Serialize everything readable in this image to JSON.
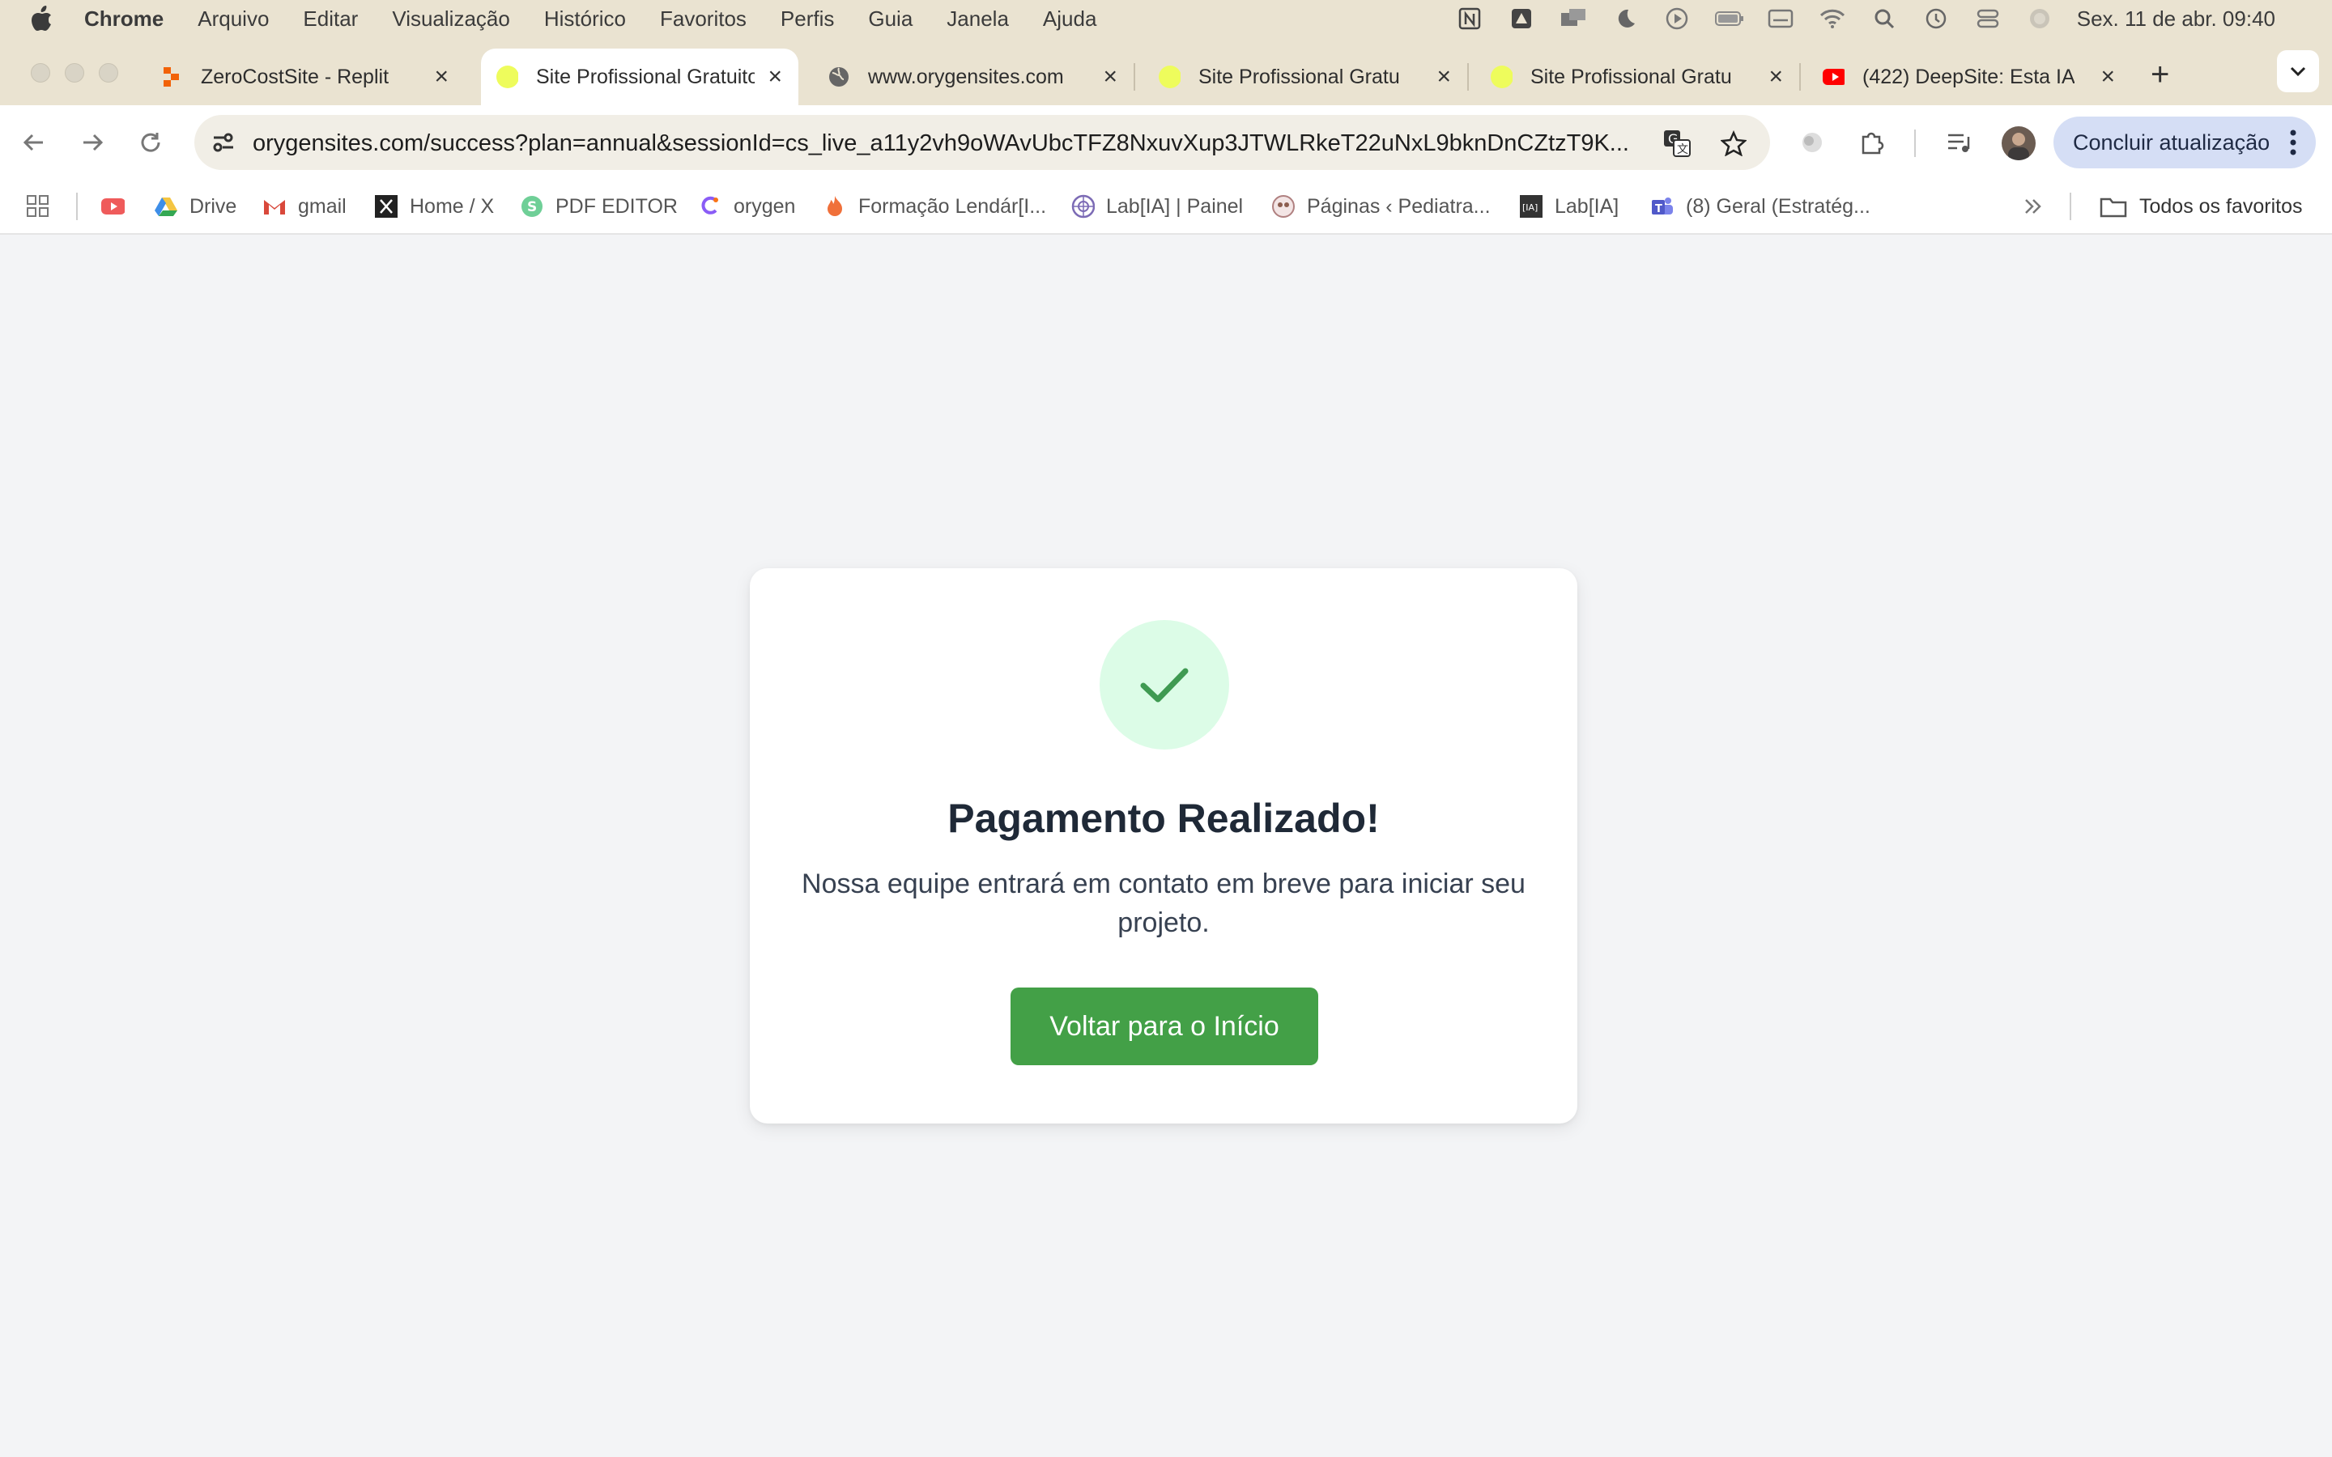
{
  "menubar": {
    "app": "Chrome",
    "items": [
      "Arquivo",
      "Editar",
      "Visualização",
      "Histórico",
      "Favoritos",
      "Perfis",
      "Guia",
      "Janela",
      "Ajuda"
    ],
    "clock": "Sex. 11 de abr.  09:40"
  },
  "tabs": [
    {
      "title": "ZeroCostSite - Replit",
      "favicon": "replit-icon"
    },
    {
      "title": "Site Profissional Gratuito",
      "favicon": "yellow-dot-icon",
      "active": true
    },
    {
      "title": "www.orygensites.com",
      "favicon": "globe-icon"
    },
    {
      "title": "Site Profissional Gratuito",
      "favicon": "yellow-dot-icon"
    },
    {
      "title": "Site Profissional Gratuito",
      "favicon": "yellow-dot-icon"
    },
    {
      "title": "(422) DeepSite: Esta IA",
      "favicon": "youtube-icon"
    }
  ],
  "toolbar": {
    "url": "orygensites.com/success?plan=annual&sessionId=cs_live_a11y2vh9oWAvUbcTFZ8NxuvXup3JTWLRkeT22uNxL9bknDnCZtzT9K...",
    "update_label": "Concluir atualização"
  },
  "bookmarks": {
    "items": [
      {
        "label": "",
        "icon": "youtube-icon"
      },
      {
        "label": "Drive",
        "icon": "drive-icon"
      },
      {
        "label": "gmail",
        "icon": "gmail-icon"
      },
      {
        "label": "Home / X",
        "icon": "x-icon"
      },
      {
        "label": "PDF EDITOR",
        "icon": "pdf-editor-icon"
      },
      {
        "label": "orygen",
        "icon": "orygen-icon"
      },
      {
        "label": "Formação Lendár[I...",
        "icon": "flame-icon"
      },
      {
        "label": "Lab[IA] | Painel",
        "icon": "lab-icon"
      },
      {
        "label": "Páginas ‹ Pediatra...",
        "icon": "pediatra-icon"
      },
      {
        "label": "Lab[IA]",
        "icon": "labia-icon"
      },
      {
        "label": "(8) Geral (Estratég...",
        "icon": "teams-icon"
      }
    ],
    "all_label": "Todos os favoritos"
  },
  "page": {
    "title": "Pagamento Realizado!",
    "message": "Nossa equipe entrará em contato em breve para iniciar seu projeto.",
    "button": "Voltar para o Início"
  },
  "colors": {
    "success_green": "#43a047",
    "check_bg": "#dcfce7",
    "page_bg": "#f3f4f6",
    "frame_bg": "#eae3d1"
  }
}
